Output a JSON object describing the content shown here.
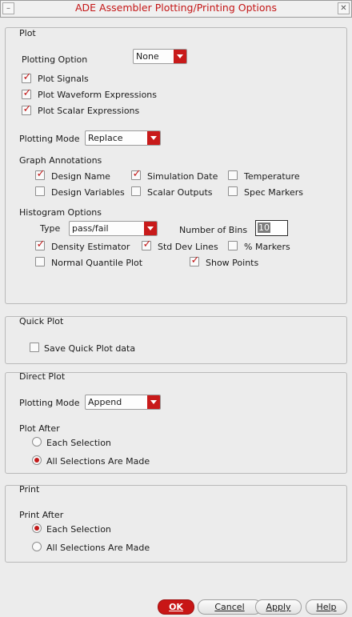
{
  "window": {
    "title": "ADE Assembler Plotting/Printing Options",
    "minimize_glyph": "–",
    "close_glyph": "✕"
  },
  "plot": {
    "group_title": "Plot",
    "plotting_option_label": "Plotting Option",
    "plotting_option_value": "None",
    "plot_signals": "Plot Signals",
    "plot_waveform_expressions": "Plot Waveform Expressions",
    "plot_scalar_expressions": "Plot Scalar Expressions",
    "plotting_mode_label": "Plotting Mode",
    "plotting_mode_value": "Replace",
    "graph_annotations": {
      "label": "Graph Annotations",
      "design_name": "Design Name",
      "simulation_date": "Simulation Date",
      "temperature": "Temperature",
      "design_variables": "Design Variables",
      "scalar_outputs": "Scalar Outputs",
      "spec_markers": "Spec Markers"
    },
    "histogram": {
      "label": "Histogram Options",
      "type_label": "Type",
      "type_value": "pass/fail",
      "bins_label": "Number of Bins",
      "bins_value": "10",
      "density_estimator": "Density Estimator",
      "std_dev_lines": "Std Dev Lines",
      "percent_markers": "% Markers",
      "normal_quantile_plot": "Normal Quantile Plot",
      "show_points": "Show Points"
    }
  },
  "quick_plot": {
    "group_title": "Quick Plot",
    "save_label": "Save Quick Plot data"
  },
  "direct_plot": {
    "group_title": "Direct Plot",
    "plotting_mode_label": "Plotting Mode",
    "plotting_mode_value": "Append",
    "plot_after_label": "Plot After",
    "each_selection": "Each Selection",
    "all_selections": "All Selections Are Made"
  },
  "print": {
    "group_title": "Print",
    "print_after_label": "Print After",
    "each_selection": "Each Selection",
    "all_selections": "All Selections Are Made"
  },
  "buttons": {
    "ok": "OK",
    "cancel": "Cancel",
    "apply": "Apply",
    "help": "Help"
  },
  "colors": {
    "accent": "#c81a1a",
    "title_text": "#c41616",
    "background": "#ececec"
  }
}
